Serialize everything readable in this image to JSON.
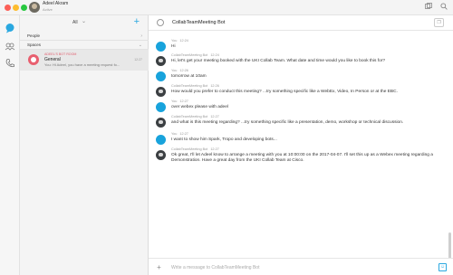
{
  "titlebar": {
    "user_name": "Adeel Akram",
    "user_status": "Active"
  },
  "list": {
    "filter_label": "All",
    "sections": {
      "people": "People",
      "spaces": "Spaces"
    },
    "space_item": {
      "tag": "ADEEL'S BOT ROOM",
      "name": "General",
      "preview": "You: Hi Adeel, you have a meeting request fo...",
      "time": "12:27"
    }
  },
  "chat": {
    "title": "CollabTeamMeeting Bot",
    "messages": [
      {
        "sender": "You",
        "time": "12:24",
        "type": "user",
        "text": "Hi"
      },
      {
        "sender": "CollabTeamMeeting Bot",
        "time": "12:24",
        "type": "bot",
        "text": "Hi, let's get your meeting booked with the UKI Collab Team. What date and time would you like to book this for?"
      },
      {
        "sender": "You",
        "time": "12:26",
        "type": "user",
        "text": "tomorrow at 10am"
      },
      {
        "sender": "CollabTeamMeeting Bot",
        "time": "12:26",
        "type": "bot",
        "text": "How would you prefer to conduct this meeting? ...try something specific like a WebEx, Video, In Person or at the EBC."
      },
      {
        "sender": "You",
        "time": "12:27",
        "type": "user",
        "text": "over webex please with adeel"
      },
      {
        "sender": "CollabTeamMeeting Bot",
        "time": "12:27",
        "type": "bot",
        "text": "and what is this meeting regarding? ...try something specific like a presentation, demo, workshop or technical discussion."
      },
      {
        "sender": "You",
        "time": "12:27",
        "type": "user",
        "text": "I want to show him Spark, Tropo and developing bots..."
      },
      {
        "sender": "CollabTeamMeeting Bot",
        "time": "12:27",
        "type": "bot",
        "text": "Ok great, I'll let Adeel know to arrange a meeting with you at 10:00:00 on the 2017-04-07. I'll set this up as a Webex meeting regarding a Demonstration. Have a great day from the UKI Collab Team at Cisco."
      }
    ],
    "composer_placeholder": "Write a message to CollabTeamMeeting Bot"
  },
  "colors": {
    "accent": "#2aa8e0",
    "user_avatar": "#18a3dc",
    "bot_avatar": "#3b3f42",
    "space_avatar": "#e85f6f"
  },
  "icons": [
    "message-icon",
    "meetings-icon",
    "phone-icon",
    "plus-icon",
    "chevron-down-icon",
    "chevron-right-icon",
    "search-icon",
    "contacts-icon",
    "emoji-icon"
  ]
}
